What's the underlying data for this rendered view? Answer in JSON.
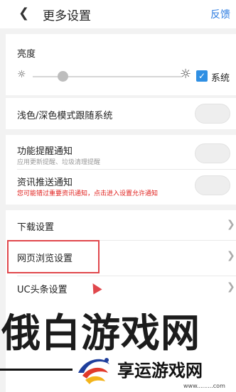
{
  "header": {
    "back_icon": "chevron-left-icon",
    "title": "更多设置",
    "feedback": "反馈"
  },
  "brightness": {
    "label": "亮度",
    "level": 0.2,
    "follow_system_checked": true,
    "follow_system_label": "系统",
    "icons": [
      "sun-small-icon",
      "sun-large-icon"
    ]
  },
  "dark_mode": {
    "label": "浅色/深色模式跟随系统",
    "enabled": false
  },
  "notifications": {
    "function_reminder": {
      "label": "功能提醒通知",
      "sub": "应用更新提醒、垃圾清理提醒",
      "enabled": false
    },
    "news_push": {
      "label": "资讯推送通知",
      "warning": "您可能错过重要资讯通知，点击进入设置允许通知",
      "enabled": false
    }
  },
  "menu": {
    "download": "下载设置",
    "web_browsing": "网页浏览设置",
    "uc_headline": "UC头条设置"
  },
  "watermark": {
    "title": "俄白游戏网",
    "logo_text": "享运游戏网",
    "url": "www.........com"
  },
  "colors": {
    "accent": "#2f7de1",
    "checkbox": "#2f8fe3",
    "warning": "#e0201d",
    "highlight": "#e0474c"
  }
}
